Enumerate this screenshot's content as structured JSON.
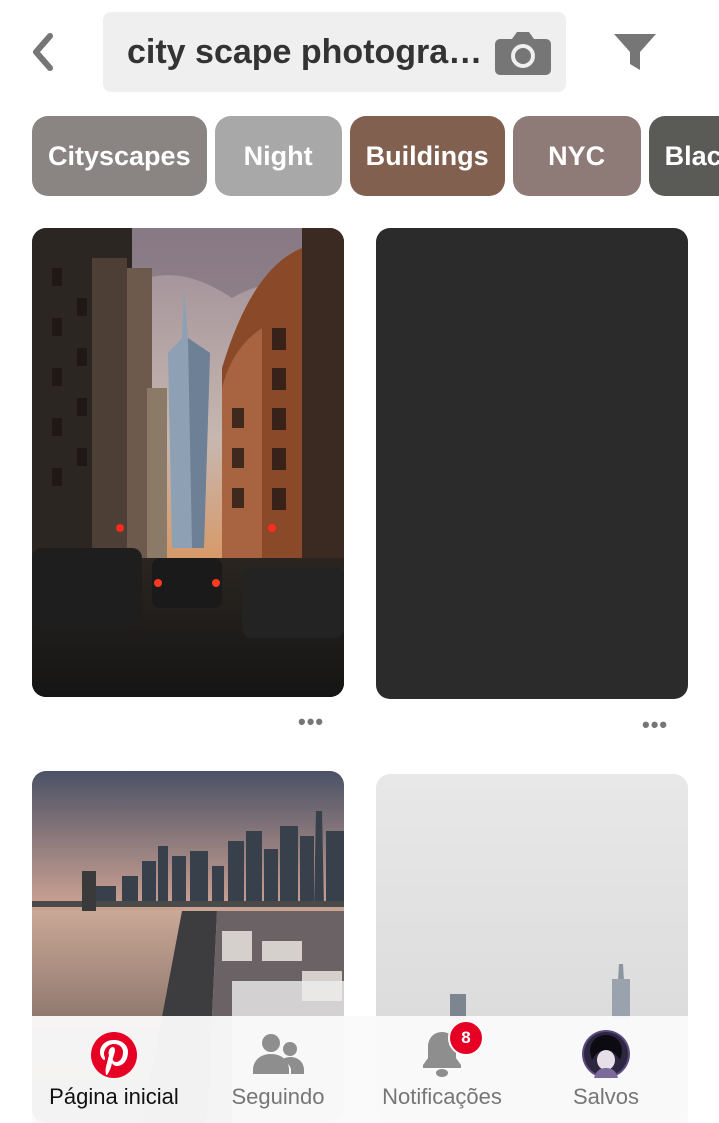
{
  "search": {
    "query": "city scape photography",
    "back_icon": "chevron-left-icon",
    "camera_icon": "camera-icon",
    "filter_icon": "filter-icon"
  },
  "chips": [
    {
      "label": "Cityscapes",
      "color": "#8a8482"
    },
    {
      "label": "Night",
      "color": "#a8a8a8"
    },
    {
      "label": "Buildings",
      "color": "#82604f"
    },
    {
      "label": "NYC",
      "color": "#8e7a76"
    },
    {
      "label": "Black and White",
      "color": "#5a5a57"
    }
  ],
  "pins": {
    "more_label": "•••"
  },
  "bottom_nav": {
    "home": {
      "label": "Página inicial",
      "icon": "pinterest-logo-icon",
      "color": "#e60023"
    },
    "following": {
      "label": "Seguindo",
      "icon": "people-icon"
    },
    "notifications": {
      "label": "Notificações",
      "icon": "bell-icon",
      "badge": "8"
    },
    "saved": {
      "label": "Salvos",
      "icon": "avatar"
    }
  },
  "colors": {
    "accent": "#e60023",
    "active_text": "#111111",
    "inactive_text": "#767676",
    "icon_gray": "#8e8e8e"
  }
}
